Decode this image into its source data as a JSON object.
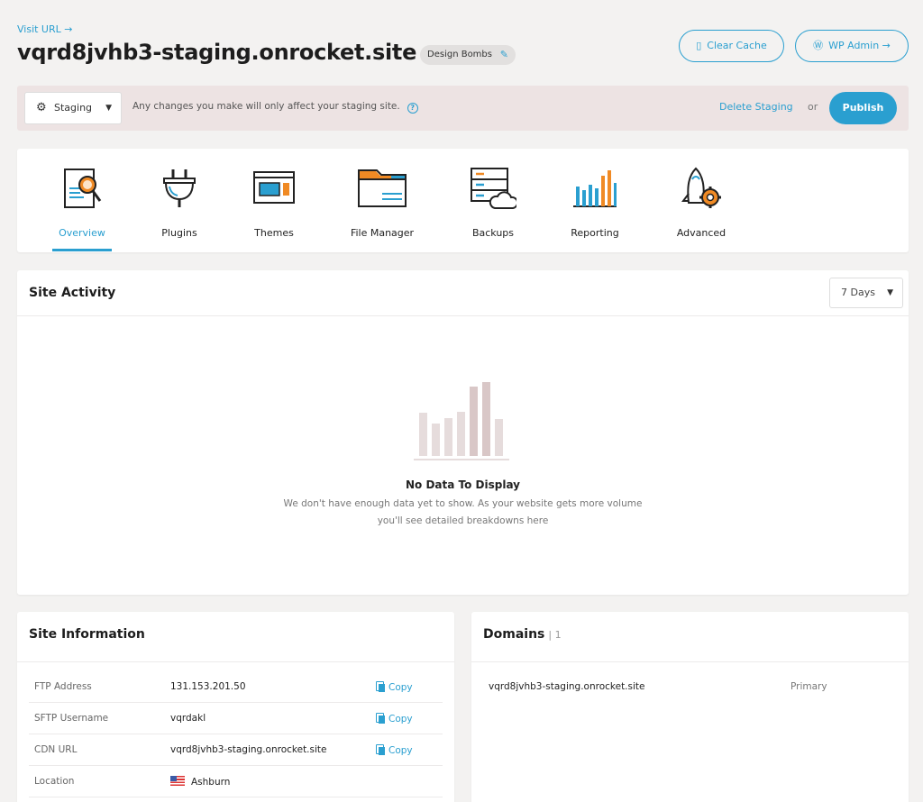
{
  "header": {
    "visit_url": "Visit URL →",
    "site_title": "vqrd8jvhb3-staging.onrocket.site",
    "tag": "Design Bombs",
    "clear_cache": "Clear Cache",
    "wp_admin": "WP Admin →"
  },
  "staging": {
    "env": "Staging",
    "note": "Any changes you make will only affect your staging site.",
    "delete": "Delete Staging",
    "or": "or",
    "publish": "Publish"
  },
  "nav": {
    "items": [
      {
        "label": "Overview",
        "icon": "overview-icon",
        "active": true
      },
      {
        "label": "Plugins",
        "icon": "plug-icon",
        "active": false
      },
      {
        "label": "Themes",
        "icon": "themes-icon",
        "active": false
      },
      {
        "label": "File Manager",
        "icon": "folder-icon",
        "active": false
      },
      {
        "label": "Backups",
        "icon": "backups-icon",
        "active": false
      },
      {
        "label": "Reporting",
        "icon": "chart-icon",
        "active": false
      },
      {
        "label": "Advanced",
        "icon": "rocket-gear-icon",
        "active": false
      }
    ]
  },
  "activity": {
    "title": "Site Activity",
    "range": "7 Days",
    "empty_title": "No Data To Display",
    "empty_desc": "We don't have enough data yet to show. As your website gets more volume you'll see detailed breakdowns here"
  },
  "site_info": {
    "title": "Site Information",
    "copy_label": "Copy",
    "rows": [
      {
        "key": "FTP Address",
        "value": "131.153.201.50"
      },
      {
        "key": "SFTP Username",
        "value": "vqrdakl"
      },
      {
        "key": "CDN URL",
        "value": "vqrd8jvhb3-staging.onrocket.site"
      },
      {
        "key": "Location",
        "value": "Ashburn"
      }
    ]
  },
  "domains": {
    "title": "Domains",
    "count": "| 1",
    "rows": [
      {
        "domain": "vqrd8jvhb3-staging.onrocket.site",
        "type": "Primary"
      }
    ]
  },
  "colors": {
    "accent": "#2a9fd0",
    "orange": "#f08a24",
    "banner": "#ede3e3"
  }
}
